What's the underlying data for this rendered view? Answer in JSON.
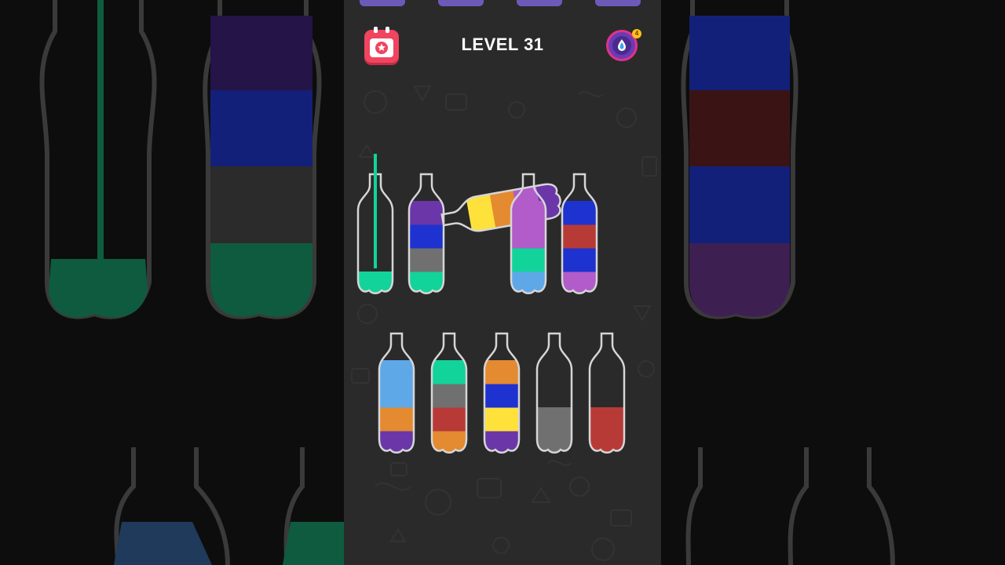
{
  "header": {
    "level_label": "LEVEL 31",
    "hint_count": "4"
  },
  "icons": {
    "calendar": "calendar-star-icon",
    "hint": "water-drop-icon"
  },
  "colors": {
    "background": "#2a2a2b",
    "calendar_button": "#f0445f",
    "hint_button": "#6b3bb6",
    "hint_ring": "#e0338a",
    "badge": "#ffc11b",
    "bottle_outline": "#d6d6d6"
  },
  "game": {
    "state": "pouring",
    "pour": {
      "from_bottle": 3,
      "to_bottle": 1,
      "liquid": "yellow"
    },
    "liquid_palette": {
      "teal": "#12d39a",
      "purple": "#6a36a8",
      "blue": "#1e32d0",
      "gray": "#707070",
      "yellow": "#ffe13c",
      "orange": "#e48a30",
      "lavender": "#b15cc9",
      "sky": "#5ea8e8",
      "red": "#b83a37"
    },
    "bottles": [
      {
        "id": 1,
        "row": 1,
        "layers": [
          "teal"
        ]
      },
      {
        "id": 2,
        "row": 1,
        "layers": [
          "teal",
          "gray",
          "blue",
          "purple"
        ]
      },
      {
        "id": 3,
        "row": 1,
        "layers": [
          "purple",
          "lavender",
          "orange",
          "yellow"
        ]
      },
      {
        "id": 4,
        "row": 1,
        "layers": [
          "sky",
          "teal",
          "lavender",
          "lavender"
        ]
      },
      {
        "id": 5,
        "row": 1,
        "layers": [
          "lavender",
          "blue",
          "red",
          "blue"
        ]
      },
      {
        "id": 6,
        "row": 2,
        "layers": [
          "purple",
          "orange",
          "sky",
          "sky"
        ]
      },
      {
        "id": 7,
        "row": 2,
        "layers": [
          "orange",
          "red",
          "gray",
          "teal"
        ]
      },
      {
        "id": 8,
        "row": 2,
        "layers": [
          "purple",
          "yellow",
          "blue",
          "orange"
        ]
      },
      {
        "id": 9,
        "row": 2,
        "layers": [
          "gray",
          "gray"
        ]
      },
      {
        "id": 10,
        "row": 2,
        "layers": [
          "red",
          "red"
        ]
      }
    ]
  }
}
